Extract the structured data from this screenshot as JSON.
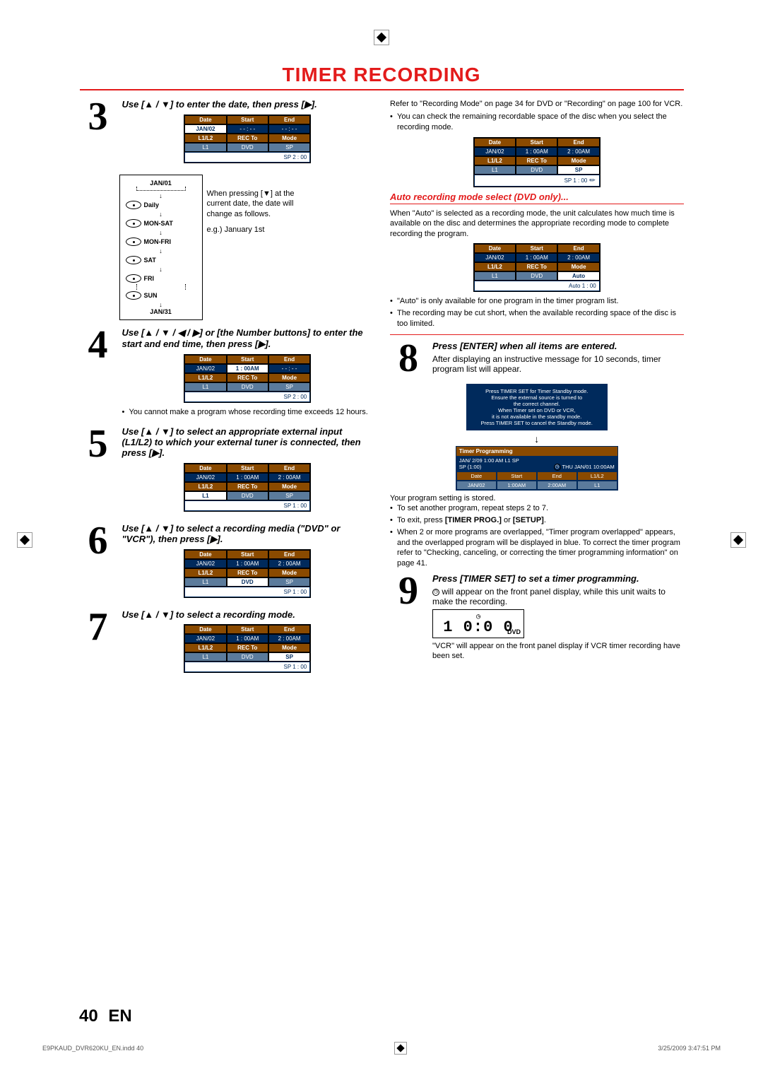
{
  "page_title": "TIMER RECORDING",
  "steps": {
    "s3": {
      "num": "3",
      "lead": "Use [▲ / ▼] to enter the date, then press [▶].",
      "table": {
        "h1": "Date",
        "h2": "Start",
        "h3": "End",
        "r1a": "JAN/02",
        "r1b": "- - : - -",
        "r1c": "- - : - -",
        "r2a": "L1/L2",
        "r2b": "REC To",
        "r2c": "Mode",
        "r3a": "L1",
        "r3b": "DVD",
        "r3c": "SP",
        "footer": "SP     2 : 00"
      }
    },
    "s4": {
      "num": "4",
      "lead": "Use [▲ / ▼ / ◀ / ▶] or [the Number buttons] to enter the start and end time, then press [▶].",
      "table": {
        "h1": "Date",
        "h2": "Start",
        "h3": "End",
        "r1a": "JAN/02",
        "r1b": "1 : 00AM",
        "r1c": "- - : - -",
        "r2a": "L1/L2",
        "r2b": "REC To",
        "r2c": "Mode",
        "r3a": "L1",
        "r3b": "DVD",
        "r3c": "SP",
        "footer": "SP     2 : 00"
      },
      "note": "You cannot make a program whose recording time exceeds 12 hours."
    },
    "s5": {
      "num": "5",
      "lead": "Use [▲ / ▼] to select an appropriate external input (L1/L2) to which your external tuner is connected, then press [▶].",
      "table": {
        "h1": "Date",
        "h2": "Start",
        "h3": "End",
        "r1a": "JAN/02",
        "r1b": "1 : 00AM",
        "r1c": "2 : 00AM",
        "r2a": "L1/L2",
        "r2b": "REC To",
        "r2c": "Mode",
        "r3a": "L1",
        "r3b": "DVD",
        "r3c": "SP",
        "footer": "SP     1 : 00"
      }
    },
    "s6": {
      "num": "6",
      "lead": "Use [▲ / ▼] to select a recording media (\"DVD\" or \"VCR\"), then press [▶].",
      "table": {
        "h1": "Date",
        "h2": "Start",
        "h3": "End",
        "r1a": "JAN/02",
        "r1b": "1 : 00AM",
        "r1c": "2 : 00AM",
        "r2a": "L1/L2",
        "r2b": "REC To",
        "r2c": "Mode",
        "r3a": "L1",
        "r3b": "DVD",
        "r3c": "SP",
        "footer": "SP     1 : 00"
      }
    },
    "s7": {
      "num": "7",
      "lead": "Use [▲ / ▼] to select a recording mode.",
      "table": {
        "h1": "Date",
        "h2": "Start",
        "h3": "End",
        "r1a": "JAN/02",
        "r1b": "1 : 00AM",
        "r1c": "2 : 00AM",
        "r2a": "L1/L2",
        "r2b": "REC To",
        "r2c": "Mode",
        "r3a": "L1",
        "r3b": "DVD",
        "r3c": "SP",
        "footer": "SP     1 : 00"
      }
    },
    "s8": {
      "num": "8",
      "lead": "Press [ENTER] when all items are entered.",
      "after": "After displaying an instructive message for 10 seconds, timer program list will appear."
    },
    "s9": {
      "num": "9",
      "lead": "Press [TIMER SET] to set a timer programming.",
      "after_pre": "",
      "after": " will appear on the front panel display, while this unit waits to make the recording."
    }
  },
  "date_flow": {
    "top": "JAN/01",
    "items": [
      "Daily",
      "MON-SAT",
      "MON-FRI",
      "SAT",
      "FRI",
      "SUN"
    ],
    "bottom": "JAN/31"
  },
  "flow_note": {
    "line1": "When pressing [▼] at the current date, the date will change as follows.",
    "line2": "e.g.) January 1st"
  },
  "right_intro": {
    "l1": "Refer to \"Recording Mode\" on page 34 for DVD or \"Recording\" on page 100 for VCR.",
    "l2": "You can check the remaining recordable space of the disc when you select the recording mode."
  },
  "right_table1": {
    "h1": "Date",
    "h2": "Start",
    "h3": "End",
    "r1a": "JAN/02",
    "r1b": "1 : 00AM",
    "r1c": "2 : 00AM",
    "r2a": "L1/L2",
    "r2b": "REC To",
    "r2c": "Mode",
    "r3a": "L1",
    "r3b": "DVD",
    "r3c": "SP",
    "footer": "SP     1 : 00"
  },
  "auto_mode": {
    "title": "Auto recording mode select (DVD only)...",
    "body": "When \"Auto\" is selected as a recording mode, the unit calculates how much time is available on the disc and determines the appropriate recording mode to complete recording the program.",
    "table": {
      "h1": "Date",
      "h2": "Start",
      "h3": "End",
      "r1a": "JAN/02",
      "r1b": "1 : 00AM",
      "r1c": "2 : 00AM",
      "r2a": "L1/L2",
      "r2b": "REC To",
      "r2c": "Mode",
      "r3a": "L1",
      "r3b": "DVD",
      "r3c": "Auto",
      "footer": "Auto    1 : 00"
    },
    "b1": "\"Auto\" is only available for one program in the timer program list.",
    "b2": "The recording may be cut short, when the available recording space of the disc is too limited."
  },
  "msg_box": {
    "l1": "Press TIMER SET for Timer Standby mode.",
    "l2": "Ensure the external source is turned to",
    "l3": "the correct channel.",
    "l4": "When Timer set on DVD or VCR,",
    "l5": "it is not available in the standby mode.",
    "l6": "Press TIMER SET to cancel the Standby mode."
  },
  "prog_box": {
    "title": "Timer Programming",
    "top": "JAN/  2/09  1:00 AM L1 SP",
    "top2": "SP  (1:00)",
    "clock": "THU JAN/01 10:00AM",
    "h1": "Date",
    "h2": "Start",
    "h3": "End",
    "h4": "L1/L2",
    "r1": "JAN/02",
    "r2": "1:00AM",
    "r3": "2:00AM",
    "r4": "L1"
  },
  "s8_bullets": {
    "pre": "Your program setting is stored.",
    "b1": "To set another program, repeat steps 2 to 7.",
    "b2": "To exit, press [TIMER PROG.] or [SETUP].",
    "b3": "When 2 or more programs are overlapped, \"Timer program overlapped\" appears, and the overlapped program will be displayed in blue. To correct the timer program refer to \"Checking, canceling, or correcting the timer programming information\" on page 41."
  },
  "lcd": {
    "digits": "1 0:0 0",
    "label": "DVD"
  },
  "s9_tail": "\"VCR\" will appear on the front panel display if VCR timer recording have been set.",
  "footer": {
    "num": "40",
    "lang": "EN",
    "file": "E9PKAUD_DVR620KU_EN.indd   40",
    "date": "3/25/2009   3:47:51 PM"
  }
}
